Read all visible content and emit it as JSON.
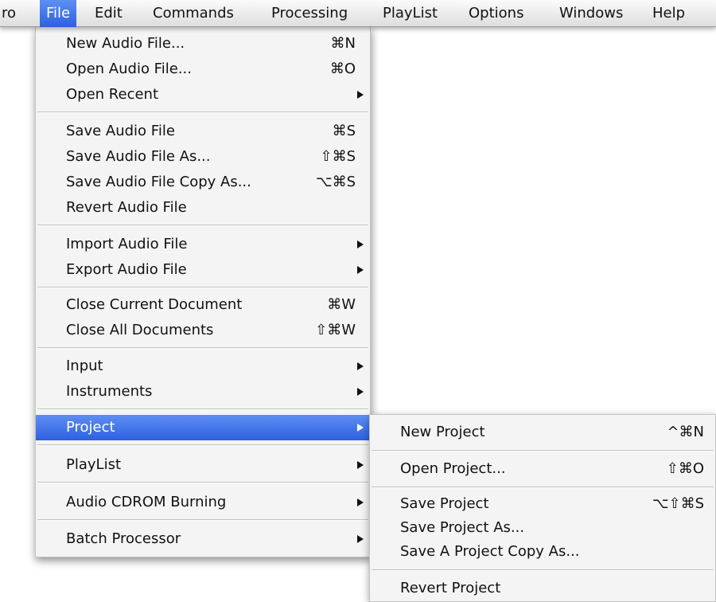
{
  "menubar": {
    "app_fragment": "ro",
    "items": [
      "File",
      "Edit",
      "Commands",
      "Processing",
      "PlayList",
      "Options",
      "Windows",
      "Help"
    ],
    "active": "File"
  },
  "file_menu": {
    "new_audio_file": {
      "label": "New Audio File...",
      "shortcut": "⌘N"
    },
    "open_audio_file": {
      "label": "Open Audio File...",
      "shortcut": "⌘O"
    },
    "open_recent": {
      "label": "Open Recent",
      "submenu": true
    },
    "save_audio_file": {
      "label": "Save Audio File",
      "shortcut": "⌘S"
    },
    "save_audio_file_as": {
      "label": "Save Audio File As...",
      "shortcut": "⇧⌘S"
    },
    "save_audio_file_copy_as": {
      "label": "Save Audio File Copy As...",
      "shortcut": "⌥⌘S"
    },
    "revert_audio_file": {
      "label": "Revert Audio File"
    },
    "import_audio_file": {
      "label": "Import Audio File",
      "submenu": true
    },
    "export_audio_file": {
      "label": "Export Audio File",
      "submenu": true
    },
    "close_current_document": {
      "label": "Close Current Document",
      "shortcut": "⌘W"
    },
    "close_all_documents": {
      "label": "Close All Documents",
      "shortcut": "⇧⌘W"
    },
    "input": {
      "label": "Input",
      "submenu": true
    },
    "instruments": {
      "label": "Instruments",
      "submenu": true
    },
    "project": {
      "label": "Project",
      "submenu": true,
      "highlighted": true
    },
    "playlist": {
      "label": "PlayList",
      "submenu": true
    },
    "audio_cdrom_burning": {
      "label": "Audio CDROM Burning",
      "submenu": true
    },
    "batch_processor": {
      "label": "Batch Processor",
      "submenu": true
    }
  },
  "project_submenu": {
    "new_project": {
      "label": "New Project",
      "shortcut": "^⌘N"
    },
    "open_project": {
      "label": "Open Project...",
      "shortcut": "⇧⌘O"
    },
    "save_project": {
      "label": "Save Project",
      "shortcut": "⌥⇧⌘S"
    },
    "save_project_as": {
      "label": "Save Project As..."
    },
    "save_project_copy_as": {
      "label": "Save A Project Copy As..."
    },
    "revert_project": {
      "label": "Revert Project"
    }
  },
  "colors": {
    "highlight": "#2f64e3",
    "menu_background": "#f4f4f4"
  }
}
